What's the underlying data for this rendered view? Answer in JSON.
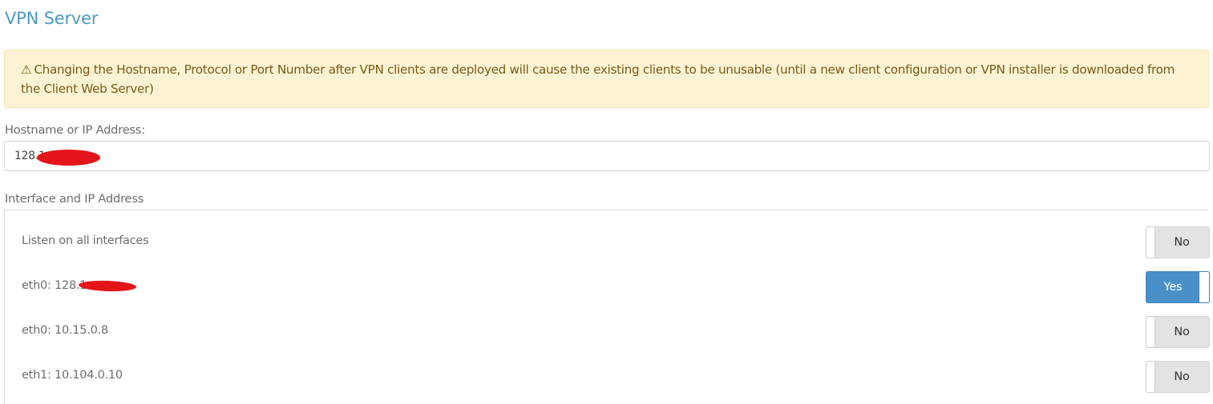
{
  "page": {
    "title": "VPN Server"
  },
  "warning": {
    "icon": "warning-triangle-icon",
    "icon_glyph": "⚠",
    "text": "Changing the Hostname, Protocol or Port Number after VPN clients are deployed will cause the existing clients to be unusable (until a new client configuration or VPN installer is downloaded from the Client Web Server)"
  },
  "hostname": {
    "label": "Hostname or IP Address:",
    "value": "128.1"
  },
  "interfaces": {
    "label": "Interface and IP Address",
    "rows": [
      {
        "label": "Listen on all interfaces",
        "toggle": "No",
        "on": false
      },
      {
        "label": "eth0: 128.1",
        "toggle": "Yes",
        "on": true
      },
      {
        "label": "eth0: 10.15.0.8",
        "toggle": "No",
        "on": false
      },
      {
        "label": "eth1: 10.104.0.10",
        "toggle": "No",
        "on": false
      }
    ]
  },
  "colors": {
    "title": "#4b9bc4",
    "warning_bg": "#fcf3d4",
    "warning_text": "#7a5b17",
    "toggle_on": "#4a90c8",
    "toggle_off": "#e3e3e3",
    "redaction": "#e3151a"
  }
}
